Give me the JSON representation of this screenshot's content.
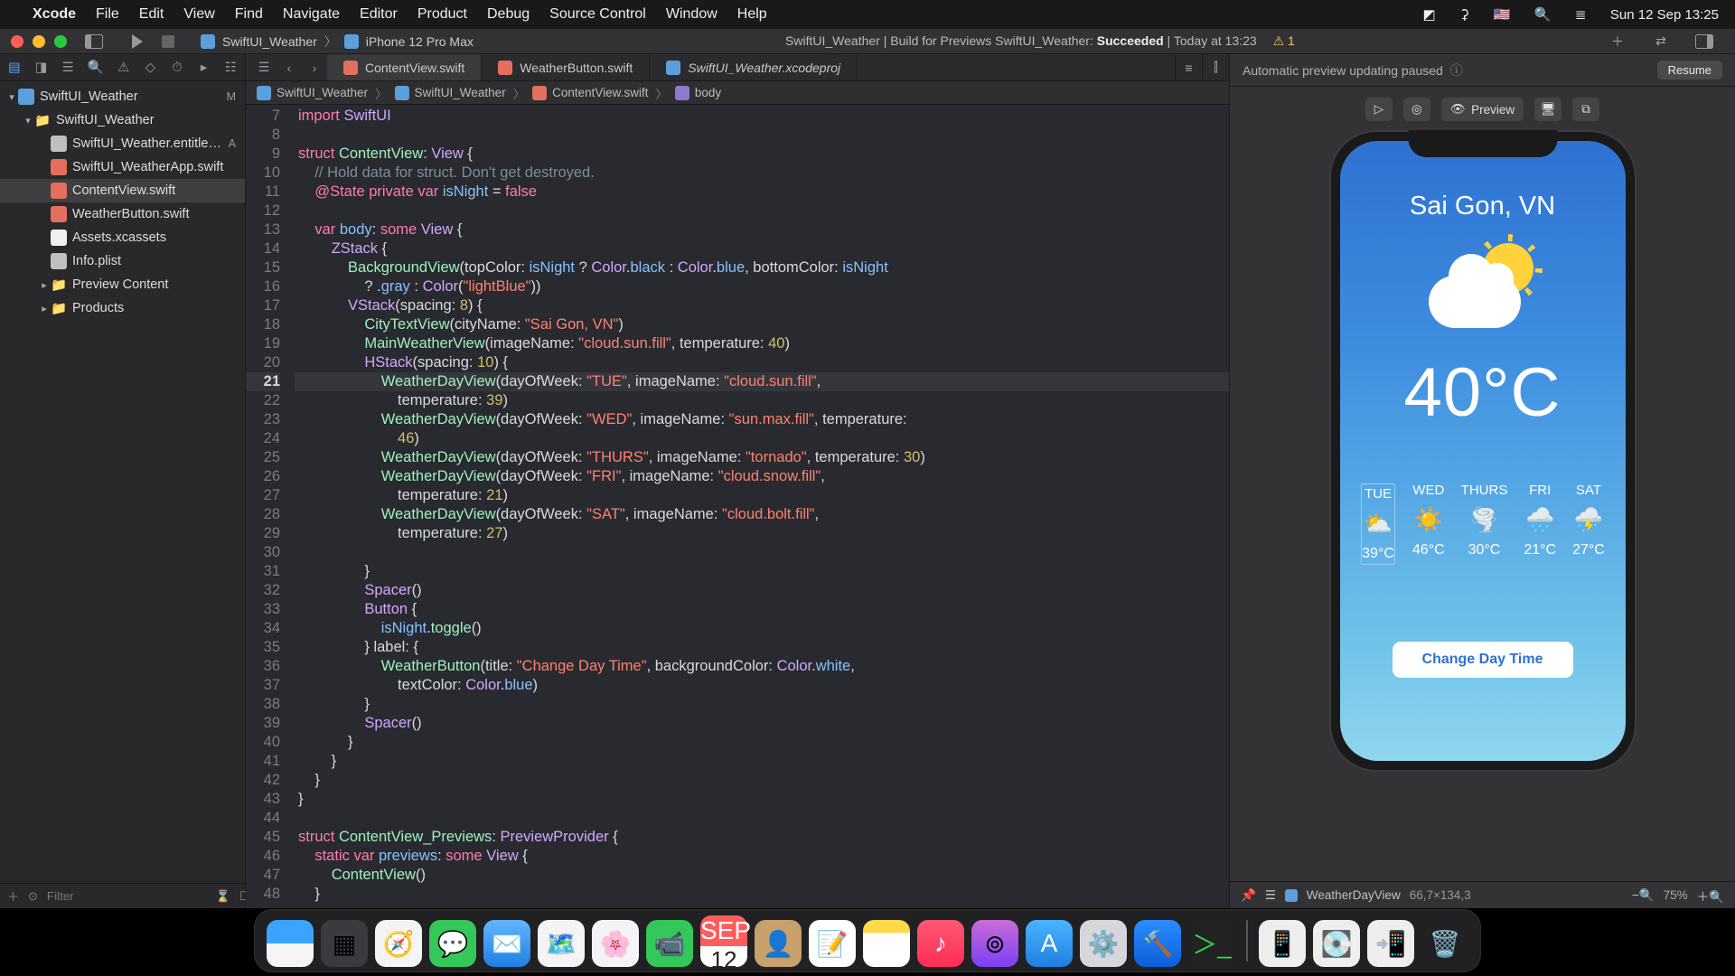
{
  "menubar": {
    "app": "Xcode",
    "items": [
      "File",
      "Edit",
      "View",
      "Find",
      "Navigate",
      "Editor",
      "Product",
      "Debug",
      "Source Control",
      "Window",
      "Help"
    ],
    "clock": "Sun 12 Sep  13:25"
  },
  "toolbar": {
    "scheme_project": "SwiftUI_Weather",
    "scheme_device": "iPhone 12 Pro Max",
    "status_prefix": "SwiftUI_Weather | Build for Previews SwiftUI_Weather: ",
    "status_result": "Succeeded",
    "status_suffix": " | Today at 13:23",
    "warning_count": "1"
  },
  "tabs": [
    {
      "label": "ContentView.swift",
      "kind": "swift",
      "active": true
    },
    {
      "label": "WeatherButton.swift",
      "kind": "swift",
      "active": false
    },
    {
      "label": "SwiftUI_Weather.xcodeproj",
      "kind": "proj",
      "active": false,
      "italic": true
    }
  ],
  "crumbs": [
    "SwiftUI_Weather",
    "SwiftUI_Weather",
    "ContentView.swift",
    "body"
  ],
  "navigator": {
    "root": "SwiftUI_Weather",
    "root_badge": "M",
    "group": "SwiftUI_Weather",
    "files": [
      {
        "name": "SwiftUI_Weather.entitle…",
        "kind": "plist",
        "badge": "A"
      },
      {
        "name": "SwiftUI_WeatherApp.swift",
        "kind": "swift"
      },
      {
        "name": "ContentView.swift",
        "kind": "swift",
        "selected": true
      },
      {
        "name": "WeatherButton.swift",
        "kind": "swift"
      },
      {
        "name": "Assets.xcassets",
        "kind": "asset"
      },
      {
        "name": "Info.plist",
        "kind": "plist"
      }
    ],
    "folders_after": [
      "Preview Content",
      "Products"
    ],
    "filter_placeholder": "Filter"
  },
  "code": {
    "first_line_no": 7,
    "highlight_line_no": 21
  },
  "canvas": {
    "paused_text": "Automatic preview updating paused",
    "resume_label": "Resume",
    "preview_label": "Preview",
    "footer_pin": "WeatherDayView",
    "footer_size": "66,7×134,3",
    "zoom_label": "75%"
  },
  "preview": {
    "city": "Sai Gon, VN",
    "main_temp": "40°C",
    "button_label": "Change Day Time",
    "days": [
      {
        "dow": "TUE",
        "icon": "⛅",
        "temp": "39°C",
        "selected": true
      },
      {
        "dow": "WED",
        "icon": "☀️",
        "temp": "46°C"
      },
      {
        "dow": "THURS",
        "icon": "🌪️",
        "temp": "30°C"
      },
      {
        "dow": "FRI",
        "icon": "🌧️",
        "temp": "21°C"
      },
      {
        "dow": "SAT",
        "icon": "⛈️",
        "temp": "27°C"
      }
    ]
  },
  "dock": {
    "calendar_month": "SEP",
    "calendar_day": "12"
  }
}
